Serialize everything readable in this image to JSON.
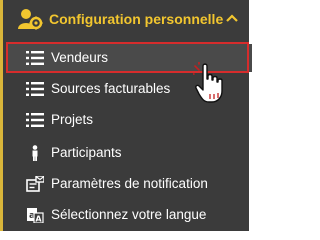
{
  "menu": {
    "header": {
      "title": "Configuration personnelle",
      "icon": "user-settings-icon",
      "toggle_icon": "chevron-up-icon"
    },
    "items": [
      {
        "label": "Vendeurs",
        "icon": "list-icon",
        "active": true
      },
      {
        "label": "Sources facturables",
        "icon": "list-icon"
      },
      {
        "label": "Projets",
        "icon": "list-icon"
      },
      {
        "label": "Participants",
        "icon": "person-icon"
      },
      {
        "label": "Paramètres de notification",
        "icon": "notification-settings-icon"
      },
      {
        "label": "Sélectionnez votre langue",
        "icon": "language-icon"
      }
    ]
  },
  "colors": {
    "background": "#3b3b3b",
    "accent": "#f2c62f",
    "highlight_border": "#d62c2c",
    "text": "#ffffff"
  }
}
